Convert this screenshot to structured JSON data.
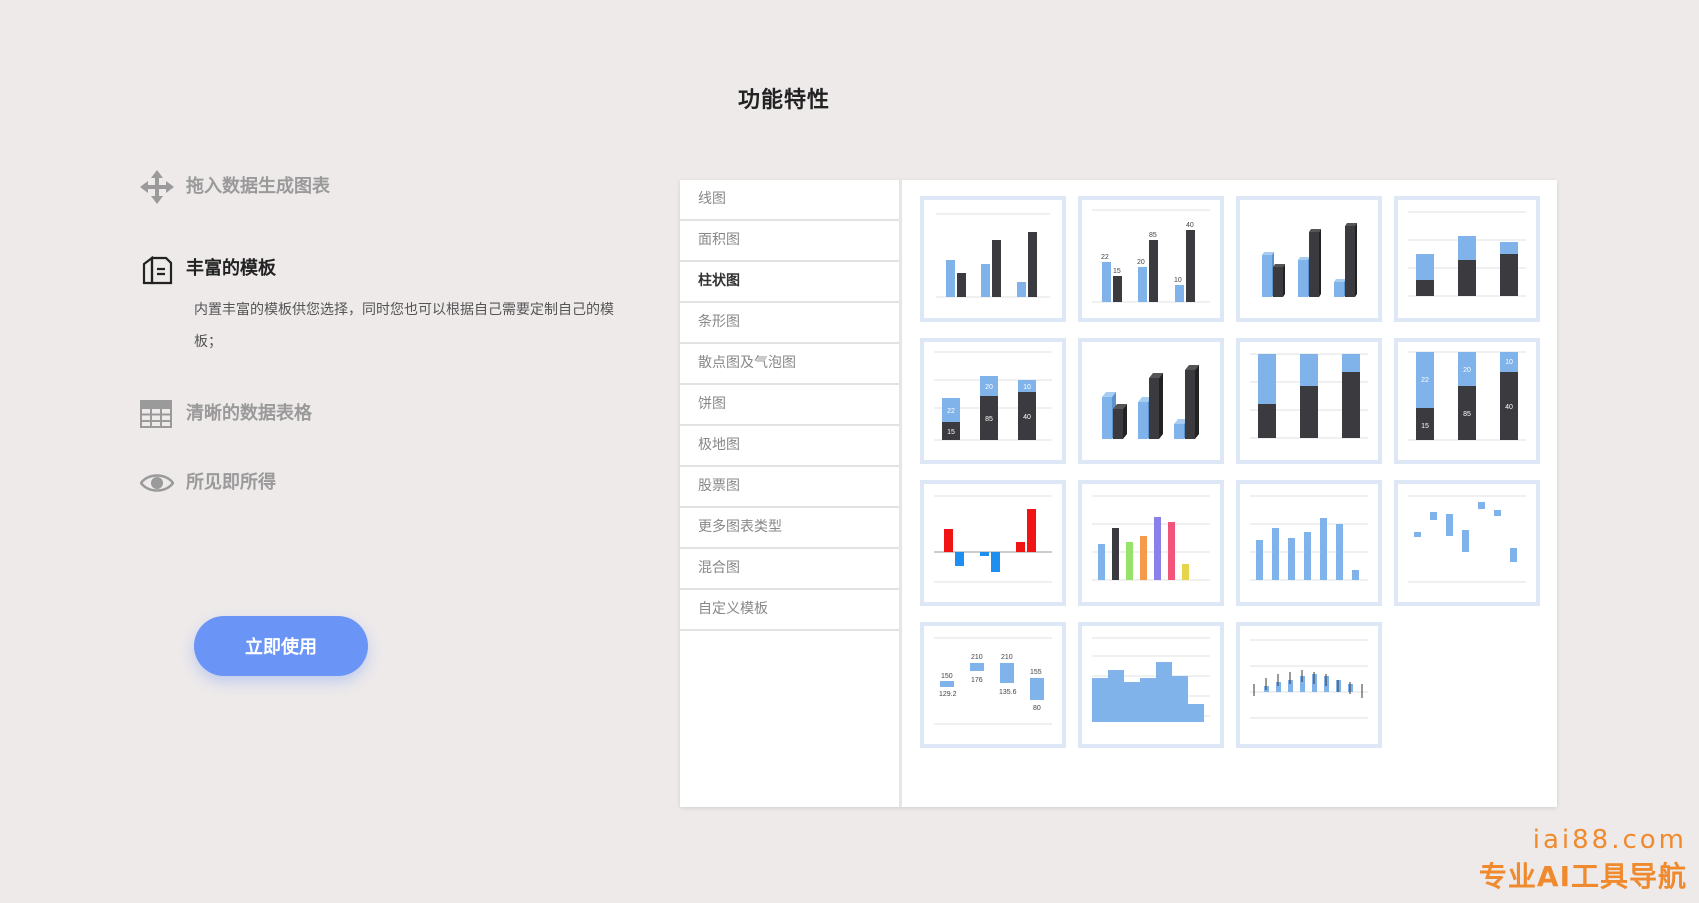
{
  "page": {
    "title": "功能特性"
  },
  "features": [
    {
      "icon": "move-arrows-icon",
      "title": "拖入数据生成图表"
    },
    {
      "icon": "template-pages-icon",
      "title": "丰富的模板",
      "desc": "内置丰富的模板供您选择，同时您也可以根据自己需要定制自己的模板；"
    },
    {
      "icon": "table-grid-icon",
      "title": "清晰的数据表格"
    },
    {
      "icon": "eye-icon",
      "title": "所见即所得"
    }
  ],
  "cta": {
    "label": "立即使用"
  },
  "categories": [
    {
      "label": "线图"
    },
    {
      "label": "面积图"
    },
    {
      "label": "柱状图",
      "active": true
    },
    {
      "label": "条形图"
    },
    {
      "label": "散点图及气泡图"
    },
    {
      "label": "饼图"
    },
    {
      "label": "极地图"
    },
    {
      "label": "股票图"
    },
    {
      "label": "更多图表类型"
    },
    {
      "label": "混合图"
    },
    {
      "label": "自定义模板"
    }
  ],
  "thumb_labels": {
    "t2": [
      "22",
      "15",
      "20",
      "85",
      "10",
      "40"
    ],
    "t5": [
      "22",
      "15",
      "20",
      "85",
      "10",
      "40"
    ],
    "t8": [
      "22",
      "15",
      "20",
      "85",
      "10",
      "40"
    ],
    "t13": [
      "150",
      "129.2",
      "210",
      "176",
      "210",
      "135.6",
      "155",
      "80"
    ]
  },
  "colors": {
    "accent": "#6a94f6",
    "bar_blue": "#7fb3ea",
    "bar_dark": "#3a3a3f",
    "thumb_border": "#dde7f6",
    "watermark": "#f08a2e"
  },
  "watermark": {
    "url": "iai88.com",
    "text": "专业AI工具导航"
  }
}
